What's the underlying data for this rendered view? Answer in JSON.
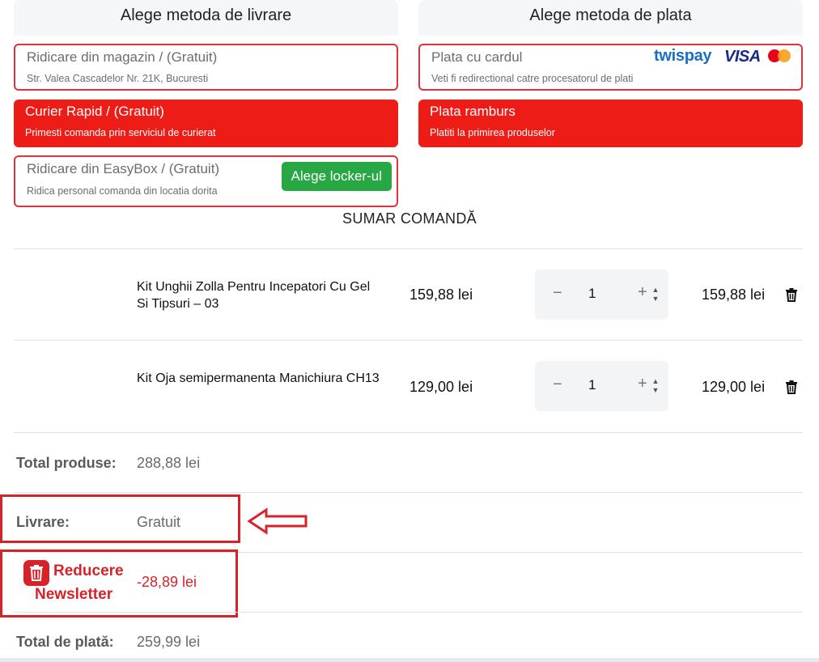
{
  "delivery": {
    "heading": "Alege metoda de livrare",
    "options": [
      {
        "title": "Ridicare din magazin / (Gratuit)",
        "subtitle": "Str. Valea Cascadelor Nr. 21K, Bucuresti"
      },
      {
        "title": "Curier Rapid / (Gratuit)",
        "subtitle": "Primesti comanda prin serviciul de curierat"
      },
      {
        "title": "Ridicare din EasyBox / (Gratuit)",
        "subtitle": "Ridica personal comanda din locatia dorita",
        "button": "Alege locker-ul"
      }
    ]
  },
  "payment": {
    "heading": "Alege metoda de plata",
    "options": [
      {
        "title": "Plata cu cardul",
        "subtitle": "Veti fi redirectional catre procesatorul de plati"
      },
      {
        "title": "Plata ramburs",
        "subtitle": "Platiti la primirea produselor"
      }
    ],
    "brands": {
      "twispay": "twispay",
      "visa": "VISA"
    }
  },
  "summary": {
    "title": "SUMAR COMANDĂ",
    "items": [
      {
        "name": "Kit Unghii Zolla Pentru Incepatori Cu Gel Si Tipsuri – 03",
        "price": "159,88 lei",
        "qty": "1",
        "total": "159,88 lei"
      },
      {
        "name": "Kit Oja semipermanenta Manichiura CH13",
        "price": "129,00 lei",
        "qty": "1",
        "total": "129,00 lei"
      }
    ],
    "qty_minus": "−",
    "qty_plus": "+",
    "totals": {
      "products_label": "Total produse:",
      "products_value": "288,88 lei",
      "delivery_label": "Livrare:",
      "delivery_value": "Gratuit",
      "discount_label_1": "Reducere",
      "discount_label_2": "Newsletter",
      "discount_value": "-28,89 lei",
      "pay_label": "Total de plată:",
      "pay_value": "259,99 lei"
    }
  },
  "colors": {
    "accent_red": "#ee1c16",
    "outline_red": "#e0323a",
    "green": "#28a745",
    "annotation_red": "#d8222a"
  }
}
